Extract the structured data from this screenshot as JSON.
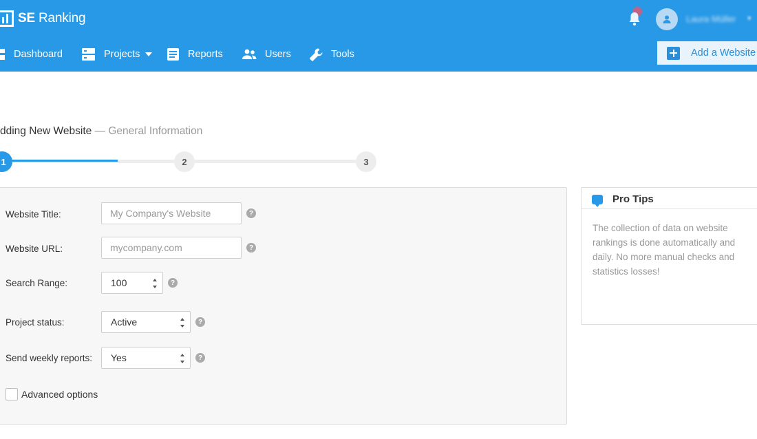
{
  "brand": {
    "name_bold": "SE",
    "name_rest": " Ranking"
  },
  "header": {
    "username": "Laura Müller",
    "add_website_label": "Add a Website"
  },
  "nav": {
    "items": [
      {
        "label": "Dashboard",
        "icon": "dashboard-icon"
      },
      {
        "label": "Projects",
        "icon": "projects-icon"
      },
      {
        "label": "Reports",
        "icon": "reports-icon"
      },
      {
        "label": "Users",
        "icon": "users-icon"
      },
      {
        "label": "Tools",
        "icon": "wrench-icon"
      }
    ]
  },
  "page": {
    "title": "dding New Website",
    "subtitle": " — General Information"
  },
  "stepper": {
    "current_step": 1,
    "steps": [
      "1",
      "2",
      "3"
    ]
  },
  "form": {
    "website_title": {
      "label": "Website Title:",
      "placeholder": "My Company's Website",
      "value": ""
    },
    "website_url": {
      "label": "Website URL:",
      "placeholder": "mycompany.com",
      "value": ""
    },
    "search_range": {
      "label": "Search Range:",
      "value": "100"
    },
    "project_status": {
      "label": "Project status:",
      "value": "Active"
    },
    "weekly_reports": {
      "label": "Send weekly reports:",
      "value": "Yes"
    },
    "advanced_options": {
      "label": "Advanced options",
      "checked": false
    },
    "help_glyph": "?"
  },
  "tips": {
    "title": "Pro Tips",
    "text": "The collection of data on website rankings is done automatically and daily. No more manual checks and statistics losses!"
  },
  "colors": {
    "brand_blue": "#2899e6",
    "panel_bg": "#f7f7f7",
    "muted_text": "#999999"
  }
}
